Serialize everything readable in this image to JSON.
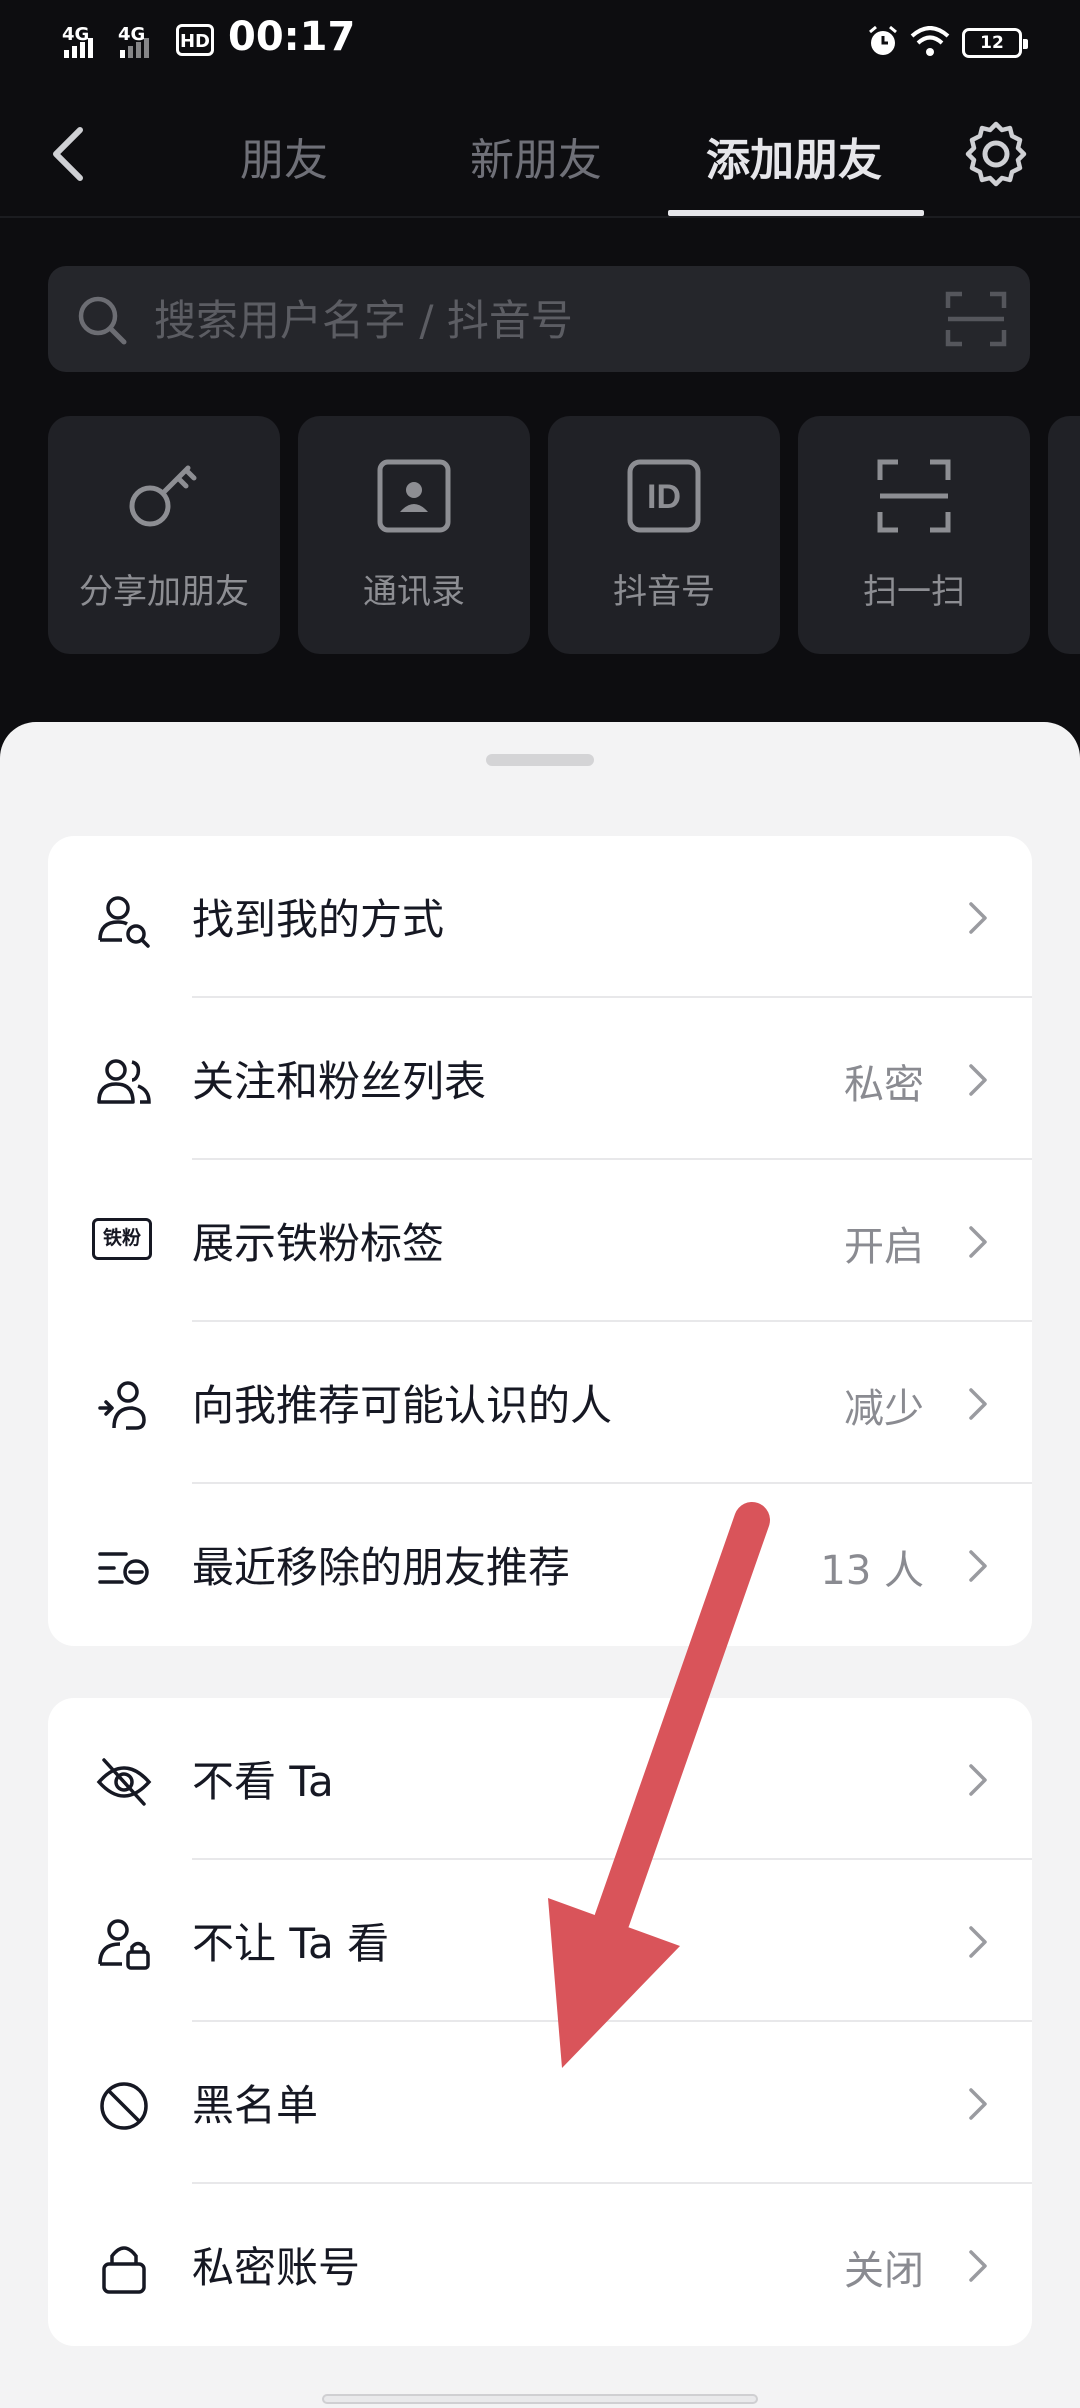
{
  "status_bar": {
    "network1": "4G",
    "network2": "4G",
    "hd": "HD",
    "time": "00:17",
    "battery": "12"
  },
  "nav": {
    "back_icon": "chevron-left-icon",
    "tabs": [
      {
        "label": "朋友"
      },
      {
        "label": "新朋友"
      },
      {
        "label": "添加朋友"
      }
    ],
    "settings_icon": "gear-icon"
  },
  "search": {
    "placeholder": "搜索用户名字 / 抖音号",
    "icon": "search-icon",
    "scan_icon": "scan-icon"
  },
  "quick_actions": [
    {
      "label": "分享加朋友",
      "icon": "key-icon"
    },
    {
      "label": "通讯录",
      "icon": "contacts-icon"
    },
    {
      "label": "抖音号",
      "icon": "id-icon"
    },
    {
      "label": "扫一扫",
      "icon": "scan-icon"
    }
  ],
  "settings_group1": [
    {
      "title": "找到我的方式",
      "value": "",
      "icon": "person-search-icon"
    },
    {
      "title": "关注和粉丝列表",
      "value": "私密",
      "icon": "people-icon"
    },
    {
      "title": "展示铁粉标签",
      "value": "开启",
      "icon": "fan-badge-icon",
      "badge_text": "铁粉"
    },
    {
      "title": "向我推荐可能认识的人",
      "value": "减少",
      "icon": "recommend-icon"
    },
    {
      "title": "最近移除的朋友推荐",
      "value": "13 人",
      "icon": "removed-list-icon"
    }
  ],
  "settings_group2": [
    {
      "title": "不看 Ta",
      "value": "",
      "icon": "eye-off-icon"
    },
    {
      "title": "不让 Ta 看",
      "value": "",
      "icon": "person-lock-icon"
    },
    {
      "title": "黑名单",
      "value": "",
      "icon": "block-icon"
    },
    {
      "title": "私密账号",
      "value": "关闭",
      "icon": "lock-icon"
    }
  ],
  "colors": {
    "dark_bg": "#0d0d10",
    "sheet_bg": "#f3f3f4",
    "annotation_arrow": "#d9545a"
  }
}
